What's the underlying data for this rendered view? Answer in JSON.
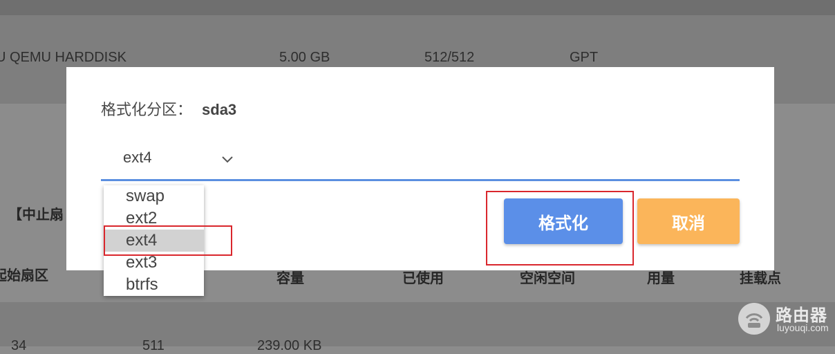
{
  "background": {
    "disk_row": {
      "model": "U QEMU HARDDISK",
      "size": "5.00 GB",
      "sector": "512/512",
      "table": "GPT"
    },
    "section_label": "【中止扇",
    "columns": [
      "起始扇区",
      "容量",
      "已使用",
      "空闲空间",
      "用量",
      "挂载点"
    ],
    "partition_row": {
      "start": "34",
      "end": "511",
      "size": "239.00 KB"
    }
  },
  "dialog": {
    "title_label": "格式化分区：",
    "partition_name": "sda3",
    "fs_select": {
      "selected": "ext4",
      "options": [
        "swap",
        "ext2",
        "ext4",
        "ext3",
        "btrfs"
      ],
      "highlighted_index": 2
    },
    "format_button": "格式化",
    "cancel_button": "取消"
  },
  "watermark": {
    "name": "路由器",
    "url": "luyouqi.com"
  },
  "colors": {
    "accent": "#5b8fe8",
    "cancel": "#fbb55a",
    "annotation": "#d9262c"
  }
}
